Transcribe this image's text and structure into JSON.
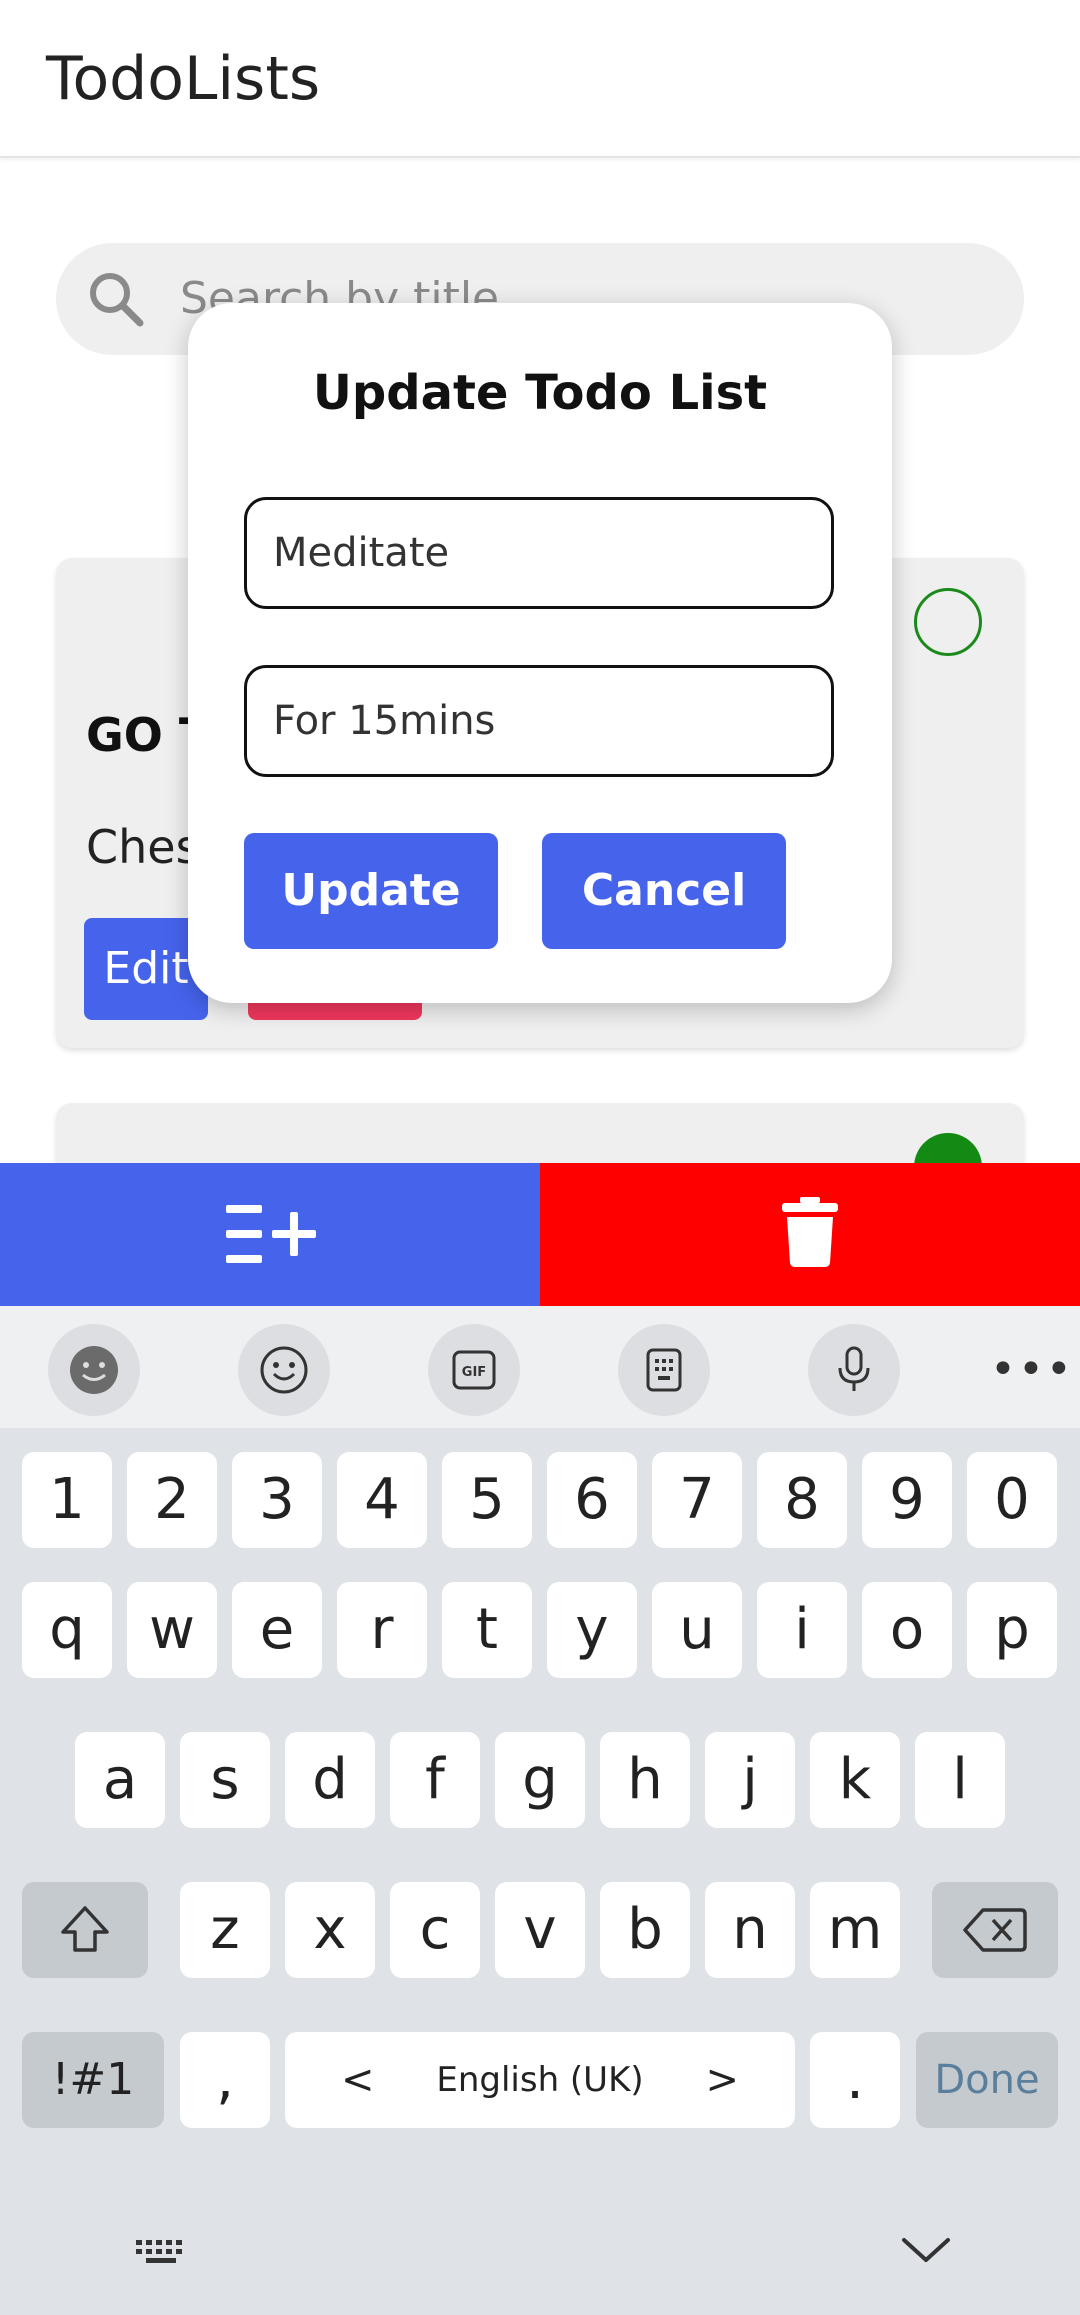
{
  "appbar": {
    "title": "TodoLists"
  },
  "search": {
    "placeholder": "Search by title"
  },
  "cards": [
    {
      "title": "GO T",
      "description": "Ches",
      "edit_label": "Edit",
      "status": "incomplete"
    },
    {
      "status": "complete"
    }
  ],
  "action_bar": {
    "add_icon": "add-list-icon",
    "delete_icon": "trash-icon"
  },
  "dialog": {
    "title": "Update Todo List",
    "title_value": "Meditate",
    "description_value": "For 15mins",
    "update_label": "Update",
    "cancel_label": "Cancel"
  },
  "keyboard": {
    "toolbar": [
      "emoji-sticker-icon",
      "smiley-icon",
      "gif-icon",
      "clipboard-icon",
      "microphone-icon",
      "more-icon"
    ],
    "more_label": "•••",
    "row_numbers": [
      "1",
      "2",
      "3",
      "4",
      "5",
      "6",
      "7",
      "8",
      "9",
      "0"
    ],
    "row1": [
      "q",
      "w",
      "e",
      "r",
      "t",
      "y",
      "u",
      "i",
      "o",
      "p"
    ],
    "row2": [
      "a",
      "s",
      "d",
      "f",
      "g",
      "h",
      "j",
      "k",
      "l"
    ],
    "row3": [
      "z",
      "x",
      "c",
      "v",
      "b",
      "n",
      "m"
    ],
    "symbols_label": "!#1",
    "comma_label": ",",
    "space_label": "English (UK)",
    "space_left": "<",
    "space_right": ">",
    "period_label": ".",
    "done_label": "Done"
  },
  "colors": {
    "primary": "#4663ec",
    "danger": "#ff0000",
    "delete_pink": "#f0375c",
    "complete_green": "#138a13"
  }
}
